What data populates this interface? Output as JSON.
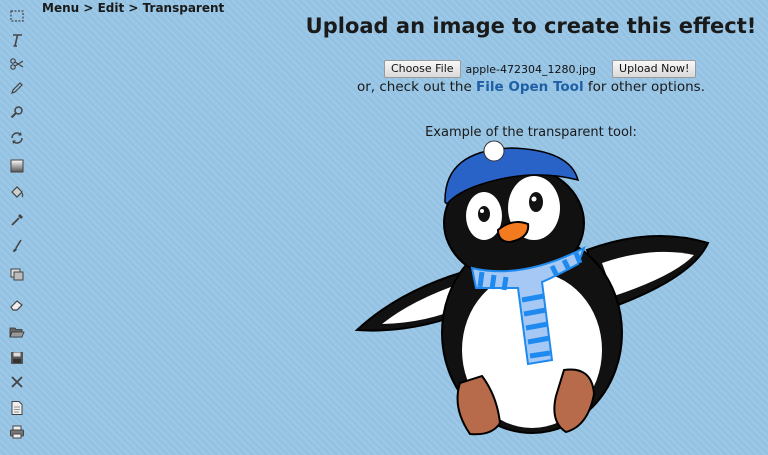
{
  "toolbar": {
    "items": [
      {
        "name": "select-icon"
      },
      {
        "name": "text-icon"
      },
      {
        "name": "scissors-icon"
      },
      {
        "name": "pencil-icon"
      },
      {
        "name": "magnifier-icon"
      },
      {
        "name": "rotate-icon"
      },
      {
        "name": "gradient-icon"
      },
      {
        "name": "paint-bucket-icon"
      },
      {
        "name": "eyedropper-icon"
      },
      {
        "name": "brush-icon"
      },
      {
        "name": "layers-icon"
      },
      {
        "name": "eraser-icon"
      },
      {
        "name": "folder-open-icon"
      },
      {
        "name": "save-icon"
      },
      {
        "name": "close-icon"
      },
      {
        "name": "document-icon"
      },
      {
        "name": "printer-icon"
      }
    ]
  },
  "breadcrumb": {
    "menu": "Menu",
    "sep1": " > ",
    "edit": "Edit",
    "sep2": " > ",
    "current": "Transparent"
  },
  "header": {
    "title": "Upload an image to create this effect!"
  },
  "upload": {
    "choose_label": "Choose File",
    "filename": "apple-472304_1280.jpg",
    "upload_label": "Upload Now!"
  },
  "alt": {
    "prefix": "or, check out the ",
    "link": "File Open Tool",
    "suffix": " for other options."
  },
  "example": {
    "label": "Example of the transparent tool:"
  },
  "colors": {
    "background": "#93c2e3",
    "link": "#1f5fa5",
    "hat": "#2a63c7",
    "scarf": "#1e8af0",
    "beak": "#f47a20",
    "feet": "#b86b4a"
  }
}
